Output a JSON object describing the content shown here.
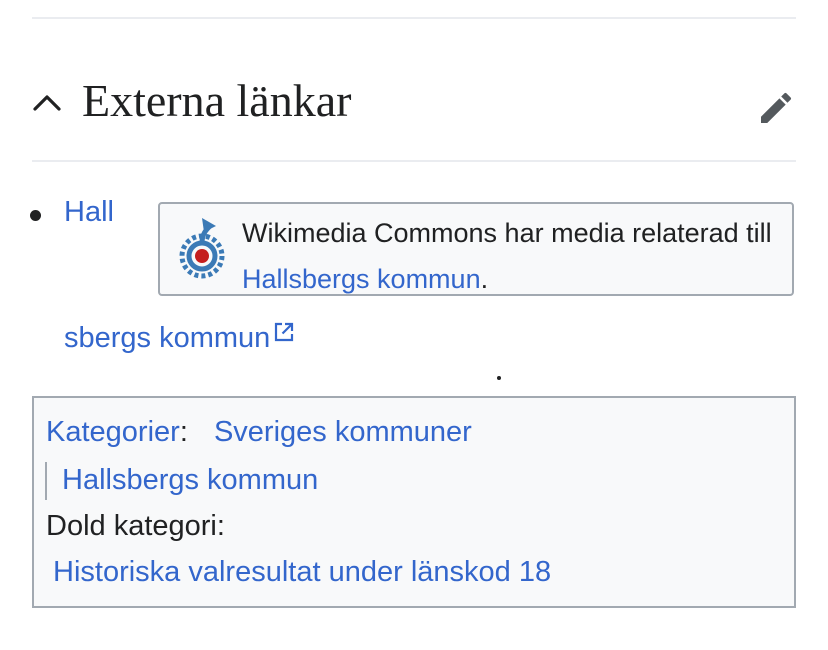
{
  "section": {
    "title": "Externa länkar"
  },
  "external_link": {
    "part1": "Hall",
    "part2": "sbergs kommun"
  },
  "commons_box": {
    "text_before": "Wikimedia Commons har media relaterad till ",
    "link": "Hallsbergs kommun",
    "text_after": "."
  },
  "categories": {
    "label": "Kategorier",
    "colon": ":",
    "items": [
      "Sveriges kommuner",
      "Hallsbergs kommun"
    ],
    "hidden_label": "Dold kategori:",
    "hidden_items": [
      "Historiska valresultat under länskod 18"
    ]
  },
  "icons": {
    "collapse": "chevron-up-icon",
    "edit": "pencil-icon",
    "external": "external-link-icon",
    "commons": "wikimedia-commons-logo"
  },
  "colors": {
    "link": "#3366cc",
    "text": "#202122",
    "box_border": "#a2a9b1",
    "box_bg": "#f8f9fa"
  }
}
